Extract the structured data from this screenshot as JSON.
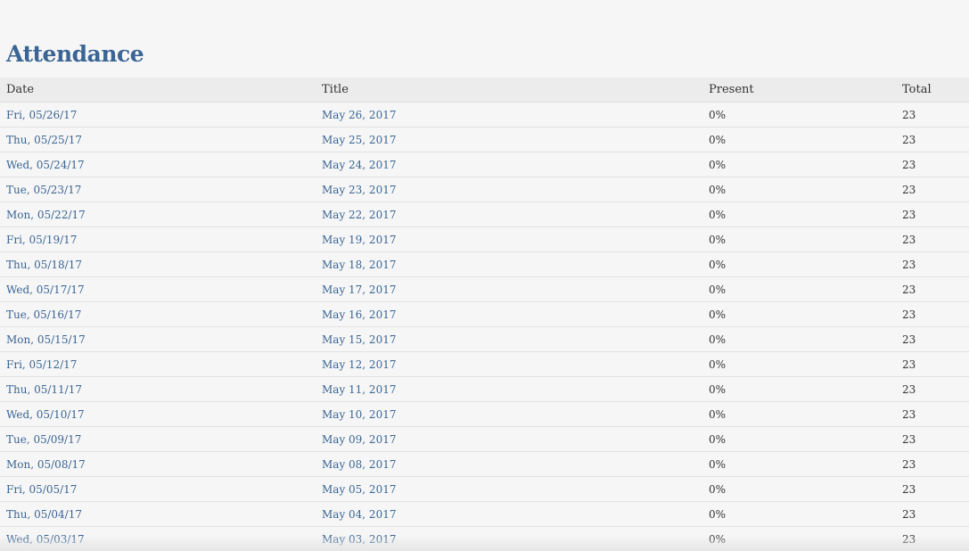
{
  "page": {
    "title": "Attendance"
  },
  "table": {
    "columns": [
      "Date",
      "Title",
      "Present",
      "Total"
    ],
    "rows": [
      {
        "date": "Fri, 05/26/17",
        "title": "May 26, 2017",
        "present": "0%",
        "total": "23"
      },
      {
        "date": "Thu, 05/25/17",
        "title": "May 25, 2017",
        "present": "0%",
        "total": "23"
      },
      {
        "date": "Wed, 05/24/17",
        "title": "May 24, 2017",
        "present": "0%",
        "total": "23"
      },
      {
        "date": "Tue, 05/23/17",
        "title": "May 23, 2017",
        "present": "0%",
        "total": "23"
      },
      {
        "date": "Mon, 05/22/17",
        "title": "May 22, 2017",
        "present": "0%",
        "total": "23"
      },
      {
        "date": "Fri, 05/19/17",
        "title": "May 19, 2017",
        "present": "0%",
        "total": "23"
      },
      {
        "date": "Thu, 05/18/17",
        "title": "May 18, 2017",
        "present": "0%",
        "total": "23"
      },
      {
        "date": "Wed, 05/17/17",
        "title": "May 17, 2017",
        "present": "0%",
        "total": "23"
      },
      {
        "date": "Tue, 05/16/17",
        "title": "May 16, 2017",
        "present": "0%",
        "total": "23"
      },
      {
        "date": "Mon, 05/15/17",
        "title": "May 15, 2017",
        "present": "0%",
        "total": "23"
      },
      {
        "date": "Fri, 05/12/17",
        "title": "May 12, 2017",
        "present": "0%",
        "total": "23"
      },
      {
        "date": "Thu, 05/11/17",
        "title": "May 11, 2017",
        "present": "0%",
        "total": "23"
      },
      {
        "date": "Wed, 05/10/17",
        "title": "May 10, 2017",
        "present": "0%",
        "total": "23"
      },
      {
        "date": "Tue, 05/09/17",
        "title": "May 09, 2017",
        "present": "0%",
        "total": "23"
      },
      {
        "date": "Mon, 05/08/17",
        "title": "May 08, 2017",
        "present": "0%",
        "total": "23"
      },
      {
        "date": "Fri, 05/05/17",
        "title": "May 05, 2017",
        "present": "0%",
        "total": "23"
      },
      {
        "date": "Thu, 05/04/17",
        "title": "May 04, 2017",
        "present": "0%",
        "total": "23"
      },
      {
        "date": "Wed, 05/03/17",
        "title": "May 03, 2017",
        "present": "0%",
        "total": "23"
      }
    ]
  },
  "colors": {
    "link": "#3a6594",
    "text": "#333333",
    "background": "#f6f6f6",
    "header_background": "#ececec"
  }
}
